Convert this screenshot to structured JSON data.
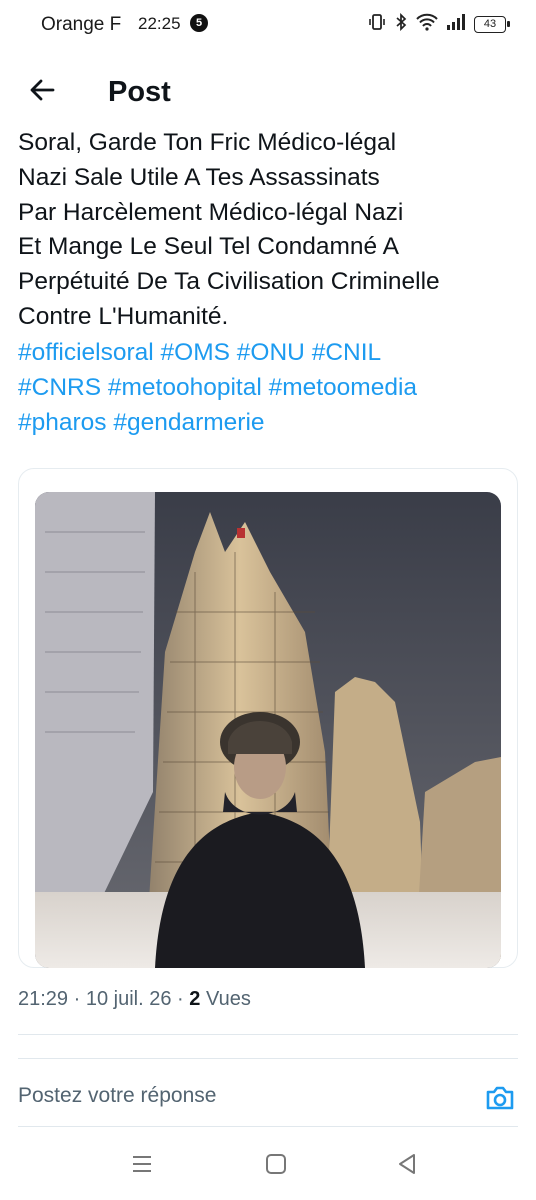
{
  "status_bar": {
    "carrier": "Orange F",
    "time": "22:25",
    "notification_count": "5",
    "battery": "43",
    "icons": [
      "vibrate-icon",
      "bluetooth-icon",
      "wifi-icon",
      "signal-icon",
      "battery-icon"
    ]
  },
  "header": {
    "back_icon": "arrow-left-icon",
    "title": "Post"
  },
  "post": {
    "text_lines": [
      "Soral, Garde Ton Fric Médico-légal",
      "Nazi Sale Utile A Tes Assassinats",
      "Par Harcèlement Médico-légal Nazi",
      "Et Mange Le Seul Tel Condamné A",
      "Perpétuité De Ta Civilisation Criminelle",
      "Contre L'Humanité."
    ],
    "hashtag_lines": [
      [
        "#officielsoral",
        "#OMS",
        "#ONU",
        "#CNIL"
      ],
      [
        "#CNRS",
        "#metoohopital",
        "#metoomedia"
      ],
      [
        "#pharos",
        "#gendarmerie"
      ]
    ],
    "link_color": "#1d9bf0",
    "time": "21:29",
    "date": "10 juil. 26",
    "views_count": "2",
    "views_label": "Vues"
  },
  "reply": {
    "placeholder": "Postez votre réponse",
    "camera_icon": "camera-icon",
    "accent": "#1d9bf0"
  },
  "nav_bar": {
    "icons": [
      "menu-icon",
      "home-square-icon",
      "back-triangle-icon"
    ]
  }
}
